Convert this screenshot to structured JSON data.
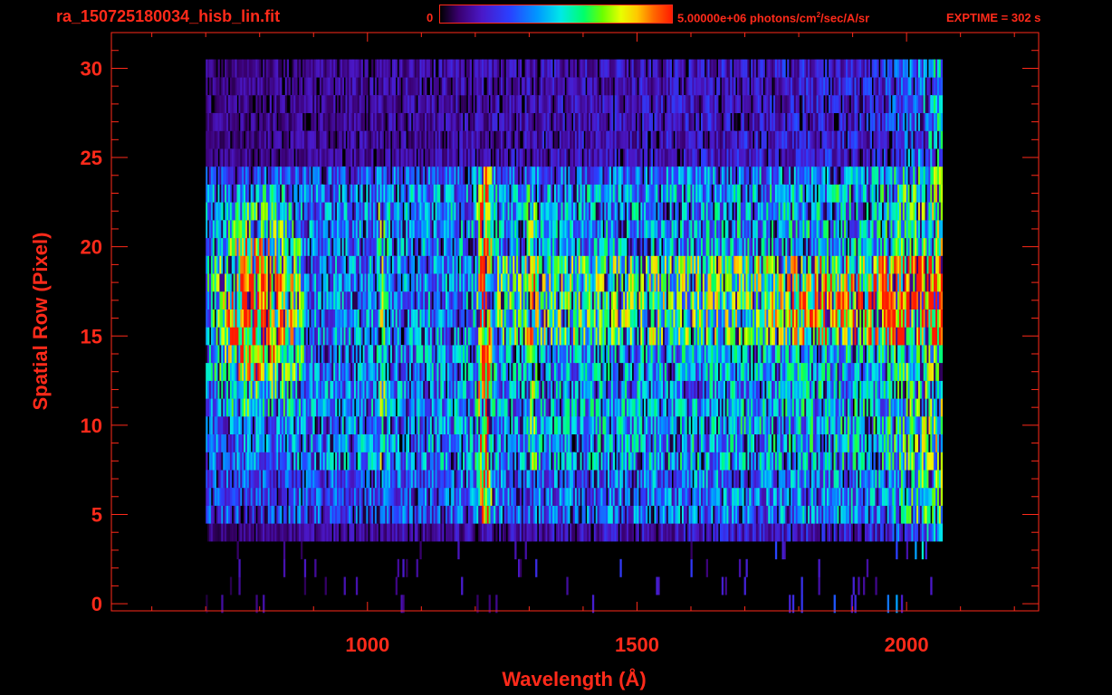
{
  "header": {
    "file_title": "ra_150725180034_hisb_lin.fit",
    "colorbar_min": "0",
    "colorbar_max": "5.00000e+06 photons/cm",
    "colorbar_unit_sup": "2",
    "colorbar_unit_rest": "/sec/A/sr",
    "exptime": "EXPTIME = 302 s"
  },
  "colors": {
    "axes": "#ff2a1a",
    "background": "#000000",
    "colormap": [
      "#000000",
      "#3a0070",
      "#4a18c8",
      "#2a40ff",
      "#0098ff",
      "#00e8e8",
      "#00ff6a",
      "#6aff00",
      "#e8ff00",
      "#ffc800",
      "#ff6a00",
      "#ff1a00"
    ]
  },
  "chart_data": {
    "type": "heatmap",
    "title": "ra_150725180034_hisb_lin.fit",
    "xlabel": "Wavelength (Å)",
    "ylabel": "Spatial Row (Pixel)",
    "xlim": [
      525,
      2245
    ],
    "ylim": [
      -0.4,
      32
    ],
    "xticks": [
      1000,
      1500,
      2000
    ],
    "yticks": [
      0,
      5,
      10,
      15,
      20,
      25,
      30
    ],
    "grid": false,
    "colorbar": {
      "min": 0,
      "max": 5000000,
      "unit": "photons/cm^2/sec/A/sr"
    },
    "exptime_s": 302,
    "data_extent": {
      "wavelength": [
        700,
        2065
      ],
      "rows": [
        0,
        30
      ]
    },
    "features": [
      {
        "name": "Lyman-alpha emission",
        "wavelength": 1216,
        "rows": [
          5,
          24
        ],
        "level": "high"
      },
      {
        "name": "broad emission blob",
        "wavelength": [
          745,
          830
        ],
        "rows": [
          13,
          20
        ],
        "level": "peak"
      },
      {
        "name": "line",
        "wavelength": 1026,
        "rows": [
          8,
          23
        ],
        "level": "medium"
      },
      {
        "name": "line",
        "wavelength": 1304,
        "rows": [
          8,
          23
        ],
        "level": "medium"
      },
      {
        "name": "continuum band",
        "wavelength": [
          1780,
          2065
        ],
        "rows": [
          15,
          19
        ],
        "level": "medium-high"
      }
    ]
  }
}
